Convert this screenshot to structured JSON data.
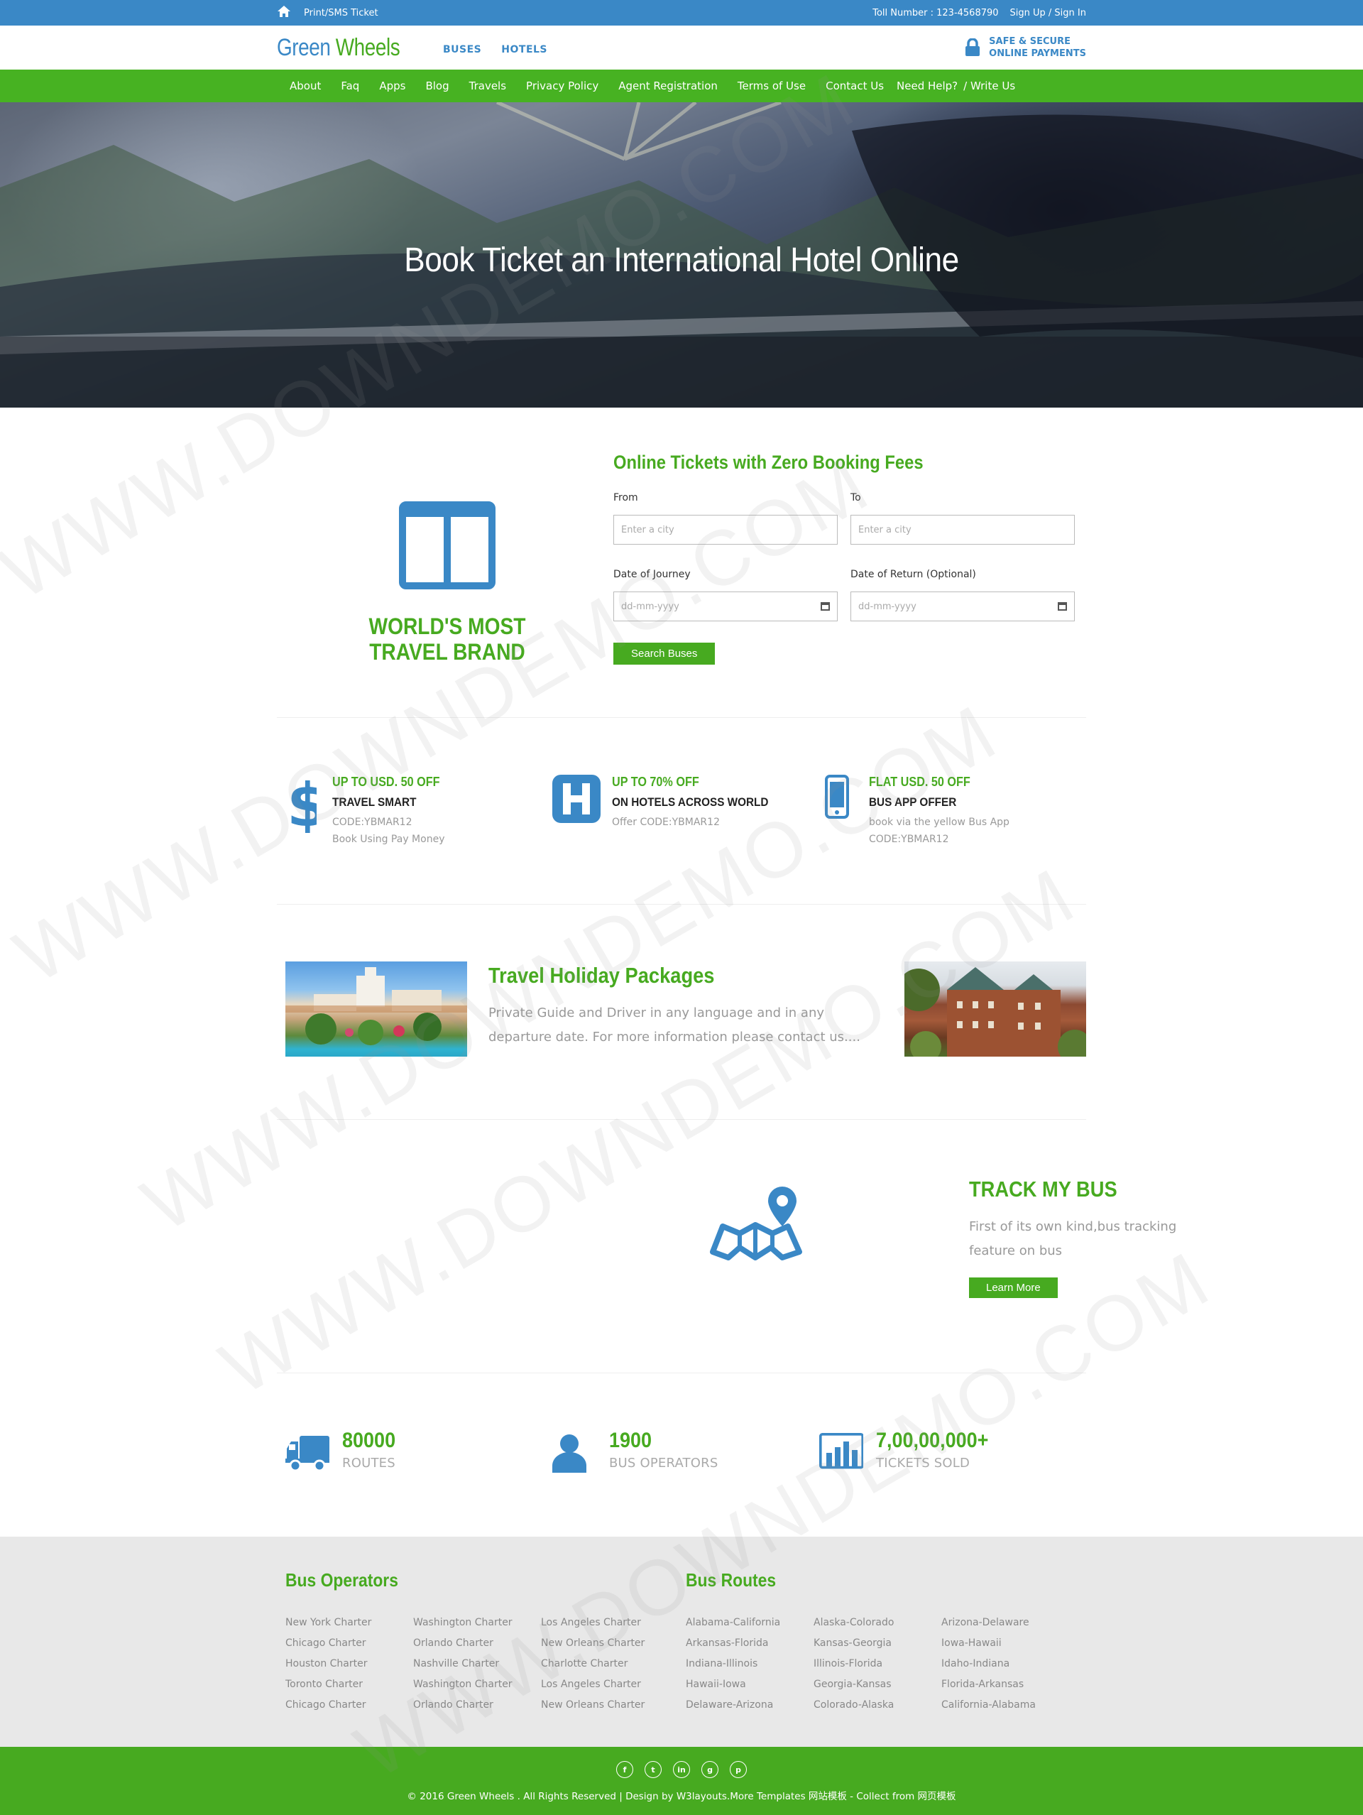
{
  "topbar": {
    "print_label": "Print/SMS Ticket",
    "toll": "Toll Number : 123-4568790",
    "signin": "Sign Up / Sign In"
  },
  "header": {
    "logo_a": "Green ",
    "logo_b": "Wheels",
    "nav": [
      "BUSES",
      "HOTELS"
    ],
    "secure_line1": "SAFE & SECURE",
    "secure_line2": "ONLINE PAYMENTS"
  },
  "greennav": {
    "items": [
      "About",
      "Faq",
      "Apps",
      "Blog",
      "Travels",
      "Privacy Policy",
      "Agent Registration",
      "Terms of Use",
      "Contact Us"
    ],
    "help": "Need Help?",
    "write": "/ Write Us"
  },
  "hero": {
    "title": "Book Ticket an International Hotel Online"
  },
  "brand": {
    "line1": "WORLD'S MOST",
    "line2": "TRAVEL BRAND"
  },
  "booking": {
    "title": "Online Tickets with Zero Booking Fees",
    "from_label": "From",
    "from_placeholder": "Enter a city",
    "to_label": "To",
    "to_placeholder": "Enter a city",
    "journey_label": "Date of Journey",
    "journey_placeholder": "dd-mm-yyyy",
    "return_label": "Date of Return (Optional)",
    "return_placeholder": "dd-mm-yyyy",
    "search_button": "Search Buses"
  },
  "offers": [
    {
      "icon": "dollar-icon",
      "title": "UP TO USD. 50 OFF",
      "subtitle": "TRAVEL SMART",
      "line1": "CODE:YBMAR12",
      "line2": "Book Using Pay Money"
    },
    {
      "icon": "hotel-icon",
      "title": "UP TO 70% OFF",
      "subtitle": "ON HOTELS ACROSS WORLD",
      "line1": "Offer CODE:YBMAR12",
      "line2": ""
    },
    {
      "icon": "mobile-icon",
      "title": "FLAT USD. 50 OFF",
      "subtitle": "BUS APP OFFER",
      "line1": "book via the yellow Bus App",
      "line2": "CODE:YBMAR12"
    }
  ],
  "packages": {
    "title": "Travel Holiday Packages",
    "text": "Private Guide and Driver in any language and in any departure date. For more information please contact us...."
  },
  "track": {
    "title": "TRACK MY BUS",
    "text": "First of its own kind,bus tracking feature on bus",
    "button": "Learn More"
  },
  "stats": [
    {
      "icon": "truck-icon",
      "num": "80000",
      "label": "ROUTES"
    },
    {
      "icon": "user-icon",
      "num": "1900",
      "label": "BUS OPERATORS"
    },
    {
      "icon": "bar-chart-icon",
      "num": "7,00,00,000+",
      "label": "TICKETS SOLD"
    }
  ],
  "footer": {
    "operators_title": "Bus Operators",
    "operators": [
      [
        "New York Charter",
        "Chicago Charter",
        "Houston Charter",
        "Toronto Charter",
        "Chicago Charter"
      ],
      [
        "Washington Charter",
        "Orlando Charter",
        "Nashville Charter",
        "Washington Charter",
        "Orlando Charter"
      ],
      [
        "Los Angeles Charter",
        "New Orleans Charter",
        "Charlotte Charter",
        "Los Angeles Charter",
        "New Orleans Charter"
      ]
    ],
    "routes_title": "Bus Routes",
    "routes": [
      [
        "Alabama-California",
        "Arkansas-Florida",
        "Indiana-Illinois",
        "Hawaii-Iowa",
        "Delaware-Arizona"
      ],
      [
        "Alaska-Colorado",
        "Kansas-Georgia",
        "Illinois-Florida",
        "Georgia-Kansas",
        "Colorado-Alaska"
      ],
      [
        "Arizona-Delaware",
        "Iowa-Hawaii",
        "Idaho-Indiana",
        "Florida-Arkansas",
        "California-Alabama"
      ]
    ],
    "social": [
      "f",
      "t",
      "in",
      "g",
      "p"
    ],
    "copyright": "© 2016 Green Wheels . All Rights Reserved | Design by W3layouts.More Templates 网站模板 - Collect from 网页模板"
  },
  "watermark": "WWW.DOWNDEMO.COM",
  "colors": {
    "blue": "#3a88c6",
    "green": "#47aa20"
  }
}
